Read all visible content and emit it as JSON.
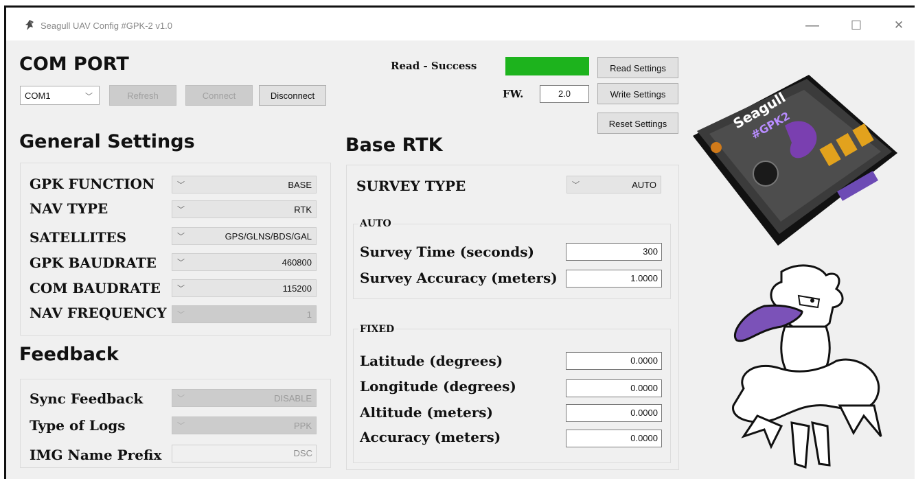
{
  "window": {
    "title": "Seagull UAV Config #GPK-2 v1.0",
    "minimize": "—",
    "maximize": "☐",
    "close": "✕"
  },
  "com_port": {
    "heading": "COM PORT",
    "port_value": "COM1",
    "refresh_label": "Refresh",
    "connect_label": "Connect",
    "disconnect_label": "Disconnect"
  },
  "status": {
    "read_label": "Read - Success",
    "indicator_color": "#1db31d",
    "fw_label": "FW.",
    "fw_value": "2.0"
  },
  "actions": {
    "read_settings": "Read Settings",
    "write_settings": "Write Settings",
    "reset_settings": "Reset Settings"
  },
  "general": {
    "heading": "General Settings",
    "rows": [
      {
        "label": "GPK FUNCTION",
        "value": "BASE"
      },
      {
        "label": "NAV TYPE",
        "value": "RTK"
      },
      {
        "label": "SATELLITES",
        "value": "GPS/GLNS/BDS/GAL"
      },
      {
        "label": "GPK BAUDRATE",
        "value": "460800"
      },
      {
        "label": "COM BAUDRATE",
        "value": "115200"
      },
      {
        "label": "NAV FREQUENCY",
        "value": "1"
      }
    ]
  },
  "feedback": {
    "heading": "Feedback",
    "rows": [
      {
        "label": "Sync Feedback",
        "value": "DISABLE"
      },
      {
        "label": "Type of Logs",
        "value": "PPK"
      },
      {
        "label": "IMG Name Prefix",
        "value": "DSC"
      }
    ]
  },
  "base_rtk": {
    "heading": "Base RTK",
    "survey_type_label": "SURVEY TYPE",
    "survey_type_value": "AUTO",
    "auto": {
      "heading": "AUTO",
      "rows": [
        {
          "label": "Survey Time (seconds)",
          "value": "300"
        },
        {
          "label": "Survey Accuracy (meters)",
          "value": "1.0000"
        }
      ]
    },
    "fixed": {
      "heading": "FIXED",
      "rows": [
        {
          "label": "Latitude (degrees)",
          "value": "0.0000"
        },
        {
          "label": "Longitude (degrees)",
          "value": "0.0000"
        },
        {
          "label": "Altitude (meters)",
          "value": "0.0000"
        },
        {
          "label": "Accuracy (meters)",
          "value": "0.0000"
        }
      ]
    }
  },
  "device": {
    "brand": "Seagull",
    "model": "#GPK2"
  }
}
